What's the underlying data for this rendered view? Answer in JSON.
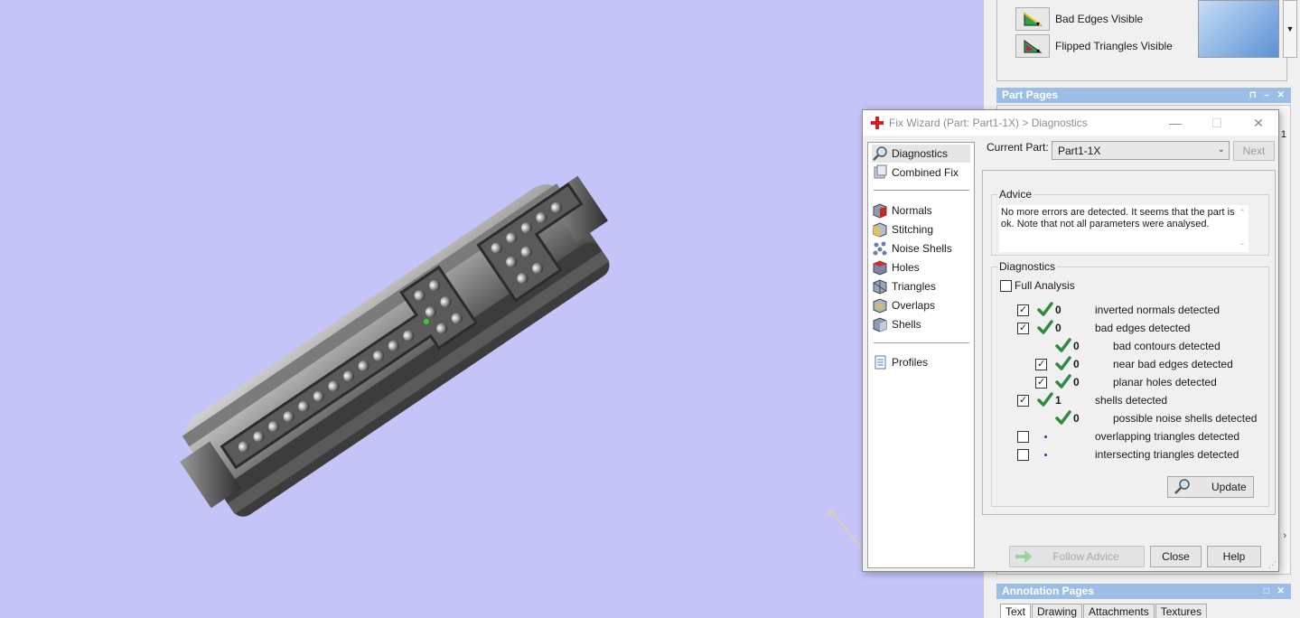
{
  "visibility": {
    "bad_edges_label": "Bad Edges Visible",
    "flipped_triangles_label": "Flipped Triangles Visible"
  },
  "part_pages": {
    "title": "Part Pages",
    "stub_text": "s: 1"
  },
  "annotation_pages": {
    "title": "Annotation Pages",
    "tabs": [
      "Text",
      "Drawing",
      "Attachments",
      "Textures"
    ]
  },
  "wizard": {
    "title": "Fix Wizard (Part: Part1-1X) > Diagnostics",
    "nav": {
      "top": [
        {
          "label": "Diagnostics",
          "icon": "magnifier-icon",
          "selected": true
        },
        {
          "label": "Combined Fix",
          "icon": "combined-fix-icon"
        }
      ],
      "middle": [
        {
          "label": "Normals",
          "icon": "normals-cube-icon"
        },
        {
          "label": "Stitching",
          "icon": "stitching-cube-icon"
        },
        {
          "label": "Noise Shells",
          "icon": "noise-shells-icon"
        },
        {
          "label": "Holes",
          "icon": "holes-cube-icon"
        },
        {
          "label": "Triangles",
          "icon": "triangles-cube-icon"
        },
        {
          "label": "Overlaps",
          "icon": "overlaps-cube-icon"
        },
        {
          "label": "Shells",
          "icon": "shells-cube-icon"
        }
      ],
      "bottom": [
        {
          "label": "Profiles",
          "icon": "profiles-document-icon"
        }
      ]
    },
    "current_part_label": "Current Part:",
    "current_part_value": "Part1-1X",
    "next_label": "Next",
    "advice": {
      "title": "Advice",
      "text": "No more errors are detected. It seems that the part is ok. Note that not all parameters were analysed."
    },
    "diagnostics": {
      "title": "Diagnostics",
      "full_analysis_label": "Full Analysis",
      "full_analysis_checked": false,
      "rows": [
        {
          "checkbox": true,
          "checked": true,
          "status": "ok",
          "count": "0",
          "label": "inverted normals detected",
          "indent": 0
        },
        {
          "checkbox": true,
          "checked": true,
          "status": "ok",
          "count": "0",
          "label": "bad edges detected",
          "indent": 0
        },
        {
          "checkbox": false,
          "checked": false,
          "status": "ok",
          "count": "0",
          "label": "bad contours detected",
          "indent": 1
        },
        {
          "checkbox": true,
          "checked": true,
          "status": "ok",
          "count": "0",
          "label": "near bad edges detected",
          "indent": 1
        },
        {
          "checkbox": true,
          "checked": true,
          "status": "ok",
          "count": "0",
          "label": "planar holes detected",
          "indent": 1
        },
        {
          "checkbox": true,
          "checked": true,
          "status": "ok",
          "count": "1",
          "label": "shells detected",
          "indent": 0
        },
        {
          "checkbox": false,
          "checked": false,
          "status": "ok",
          "count": "0",
          "label": "possible noise shells detected",
          "indent": 1
        },
        {
          "checkbox": true,
          "checked": false,
          "status": "pending",
          "count": "",
          "label": "overlapping triangles detected",
          "indent": 0
        },
        {
          "checkbox": true,
          "checked": false,
          "status": "pending",
          "count": "",
          "label": "intersecting triangles detected",
          "indent": 0
        }
      ],
      "update_label": "Update"
    },
    "buttons": {
      "follow_advice": "Follow Advice",
      "close": "Close",
      "help": "Help"
    }
  },
  "colors": {
    "viewport_bg": "#c4c4f8",
    "panel_header": "#9bbde6",
    "check_green": "#2e8b3e"
  }
}
